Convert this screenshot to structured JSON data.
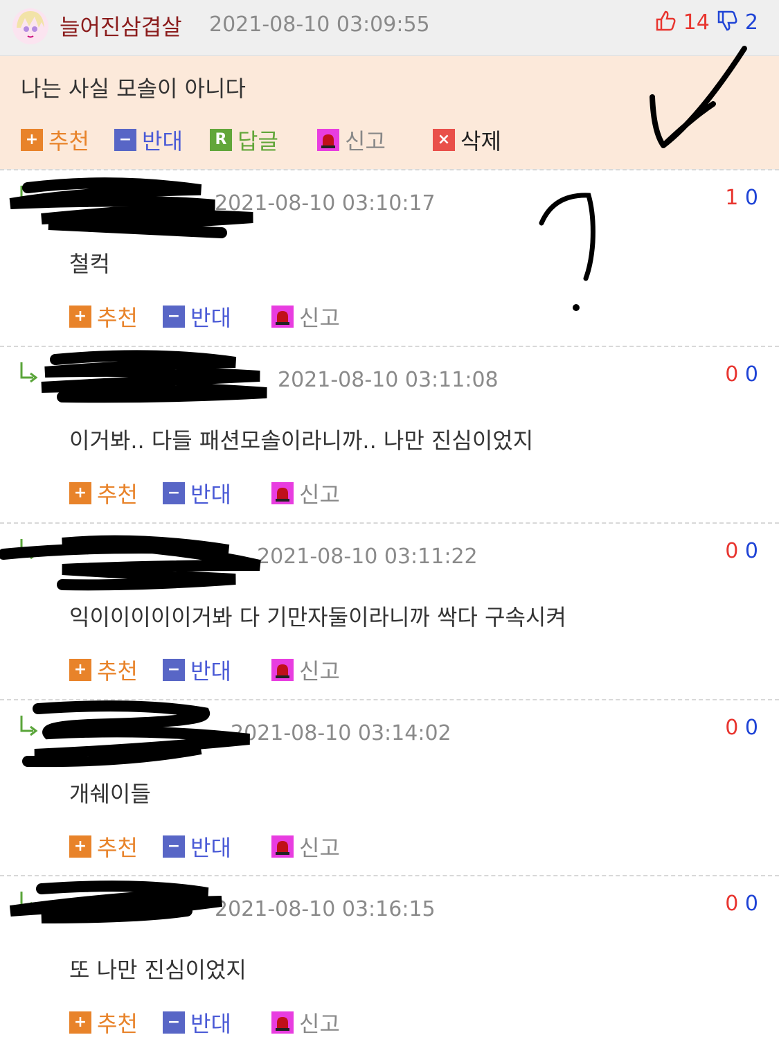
{
  "post": {
    "author": "늘어진삼겹살",
    "timestamp": "2021-08-10 03:09:55",
    "upvotes": "14",
    "downvotes": "2",
    "text": "나는 사실 모솔이 아니다",
    "actions": {
      "recommend": "추천",
      "oppose": "반대",
      "reply": "답글",
      "report": "신고",
      "delete": "삭제"
    }
  },
  "comment_actions": {
    "recommend": "추천",
    "oppose": "반대",
    "report": "신고"
  },
  "comments": [
    {
      "timestamp": "2021-08-10 03:10:17",
      "up": "1",
      "down": "0",
      "text": "철컥"
    },
    {
      "timestamp": "2021-08-10 03:11:08",
      "up": "0",
      "down": "0",
      "text": "이거봐.. 다들 패션모솔이라니까.. 나만 진심이었지"
    },
    {
      "timestamp": "2021-08-10 03:11:22",
      "up": "0",
      "down": "0",
      "text": "익이이이이이거봐 다 기만자둘이라니까 싹다 구속시켜"
    },
    {
      "timestamp": "2021-08-10 03:14:02",
      "up": "0",
      "down": "0",
      "text": "개쉐이들"
    },
    {
      "timestamp": "2021-08-10 03:16:15",
      "up": "0",
      "down": "0",
      "text": "또 나만 진심이었지"
    }
  ],
  "icons": {
    "upvote": "thumbs-up-icon",
    "downvote": "thumbs-down-icon",
    "reply_indicator": "reply-arrow-icon",
    "report": "siren-icon"
  },
  "colors": {
    "author": "#8b1c1c",
    "post_background": "#fce9da",
    "header_background": "#efefef",
    "upvote": "#e8352f",
    "downvote": "#1f44d6",
    "recommend": "#e8832a",
    "oppose": "#5866c6",
    "reply": "#62a63a"
  }
}
